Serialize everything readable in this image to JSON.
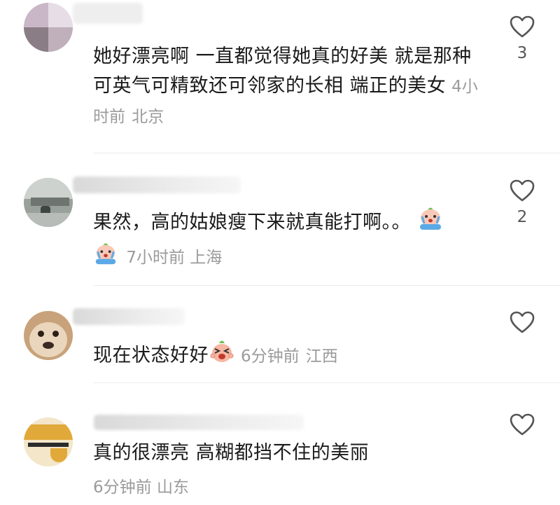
{
  "comments": [
    {
      "text": "她好漂亮啊 一直都觉得她真的好美 就是那种可英气可精致还可邻家的长相 端正的美女",
      "time": "4小时前",
      "location": "北京",
      "likes": "3",
      "icons": [
        "avatar-photo",
        "heart-outline-icon"
      ]
    },
    {
      "text": "果然，高的姑娘瘦下来就真能打啊。。",
      "time": "7小时前",
      "location": "上海",
      "likes": "2",
      "icons": [
        "avatar-photo",
        "crying-emoji-icon",
        "heart-outline-icon"
      ]
    },
    {
      "text": "现在状态好好",
      "time": "6分钟前",
      "location": "江西",
      "likes": "",
      "icons": [
        "avatar-dog-photo",
        "excited-emoji-icon",
        "heart-outline-icon"
      ]
    },
    {
      "text": "真的很漂亮 高糊都挡不住的美丽",
      "time": "6分钟前",
      "location": "山东",
      "likes": "",
      "icons": [
        "avatar-cartoon",
        "heart-outline-icon"
      ]
    }
  ],
  "colors": {
    "text": "#1a1a1a",
    "meta": "#9b9b9b",
    "divider": "#ececec",
    "heart_stroke": "#555555"
  }
}
